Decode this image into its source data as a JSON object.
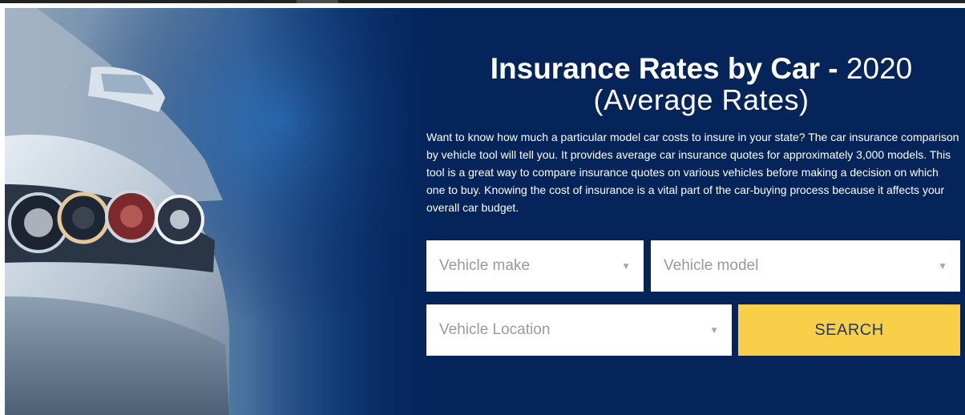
{
  "hero": {
    "title_bold": "Insurance Rates by Car -",
    "title_year": "2020",
    "subtitle": "(Average Rates)",
    "intro": "Want to know how much a particular model car costs to insure in your state? The car insurance comparison by vehicle tool will tell you. It provides average car insurance quotes for approximately 3,000 models. This tool is a great way to compare insurance quotes on various vehicles before making a decision on which one to buy. Knowing the cost of insurance is a vital part of the car-buying process because it affects your overall car budget."
  },
  "form": {
    "make_placeholder": "Vehicle make",
    "model_placeholder": "Vehicle model",
    "location_placeholder": "Vehicle Location",
    "search_label": "SEARCH"
  },
  "icons": {
    "dropdown": "chevron-down-icon",
    "hero_image": "car-headlight-image"
  },
  "colors": {
    "background": "#04245a",
    "accent": "#f9cf4a",
    "button_text": "#243b60"
  }
}
